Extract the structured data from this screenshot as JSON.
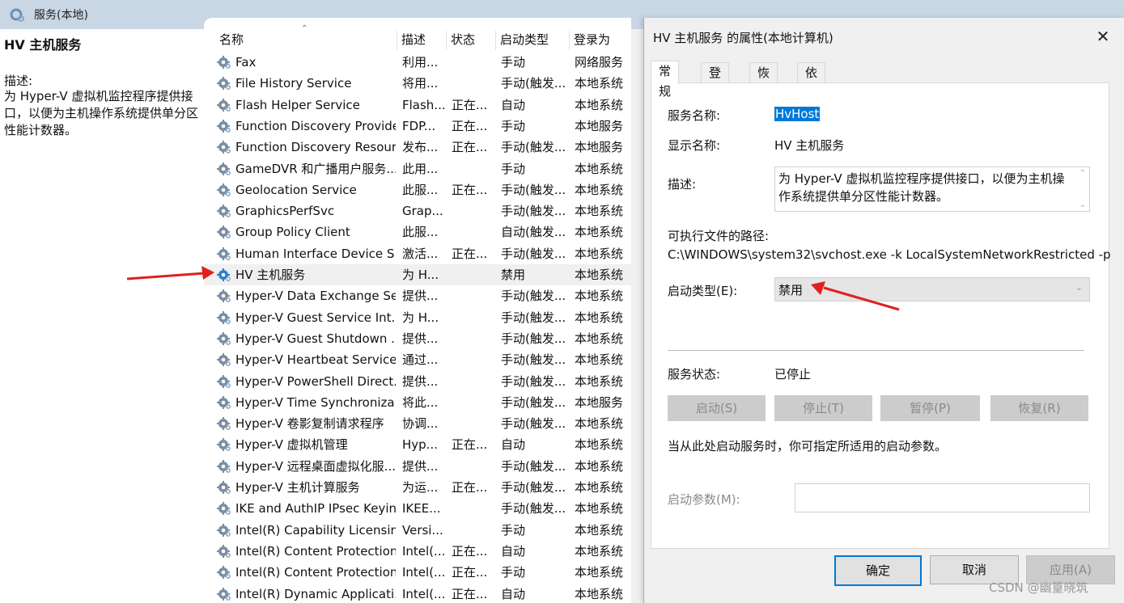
{
  "window": {
    "title": "服务(本地)"
  },
  "left_pane": {
    "service_title": "HV 主机服务",
    "description_label": "描述:",
    "description_text": "为 Hyper-V 虚拟机监控程序提供接口，以便为主机操作系统提供单分区性能计数器。"
  },
  "list": {
    "headers": {
      "name": "名称",
      "desc": "描述",
      "status": "状态",
      "startup": "启动类型",
      "logon": "登录为"
    },
    "rows": [
      {
        "name": "Fax",
        "desc": "利用...",
        "status": "",
        "startup": "手动",
        "logon": "网络服务"
      },
      {
        "name": "File History Service",
        "desc": "将用...",
        "status": "",
        "startup": "手动(触发...",
        "logon": "本地系统"
      },
      {
        "name": "Flash Helper Service",
        "desc": "Flash...",
        "status": "正在...",
        "startup": "自动",
        "logon": "本地系统"
      },
      {
        "name": "Function Discovery Provide...",
        "desc": "FDP...",
        "status": "正在...",
        "startup": "手动",
        "logon": "本地服务"
      },
      {
        "name": "Function Discovery Resour...",
        "desc": "发布...",
        "status": "正在...",
        "startup": "手动(触发...",
        "logon": "本地服务"
      },
      {
        "name": "GameDVR 和广播用户服务...",
        "desc": "此用...",
        "status": "",
        "startup": "手动",
        "logon": "本地系统"
      },
      {
        "name": "Geolocation Service",
        "desc": "此服...",
        "status": "正在...",
        "startup": "手动(触发...",
        "logon": "本地系统"
      },
      {
        "name": "GraphicsPerfSvc",
        "desc": "Grap...",
        "status": "",
        "startup": "手动(触发...",
        "logon": "本地系统"
      },
      {
        "name": "Group Policy Client",
        "desc": "此服...",
        "status": "",
        "startup": "自动(触发...",
        "logon": "本地系统"
      },
      {
        "name": "Human Interface Device S...",
        "desc": "激活...",
        "status": "正在...",
        "startup": "手动(触发...",
        "logon": "本地系统"
      },
      {
        "name": "HV 主机服务",
        "desc": "为 H...",
        "status": "",
        "startup": "禁用",
        "logon": "本地系统"
      },
      {
        "name": "Hyper-V Data Exchange Se...",
        "desc": "提供...",
        "status": "",
        "startup": "手动(触发...",
        "logon": "本地系统"
      },
      {
        "name": "Hyper-V Guest Service Int...",
        "desc": "为 H...",
        "status": "",
        "startup": "手动(触发...",
        "logon": "本地系统"
      },
      {
        "name": "Hyper-V Guest Shutdown ...",
        "desc": "提供...",
        "status": "",
        "startup": "手动(触发...",
        "logon": "本地系统"
      },
      {
        "name": "Hyper-V Heartbeat Service",
        "desc": "通过...",
        "status": "",
        "startup": "手动(触发...",
        "logon": "本地系统"
      },
      {
        "name": "Hyper-V PowerShell Direct...",
        "desc": "提供...",
        "status": "",
        "startup": "手动(触发...",
        "logon": "本地系统"
      },
      {
        "name": "Hyper-V Time Synchroniza...",
        "desc": "将此...",
        "status": "",
        "startup": "手动(触发...",
        "logon": "本地服务"
      },
      {
        "name": "Hyper-V 卷影复制请求程序",
        "desc": "协调...",
        "status": "",
        "startup": "手动(触发...",
        "logon": "本地系统"
      },
      {
        "name": "Hyper-V 虚拟机管理",
        "desc": "Hyp...",
        "status": "正在...",
        "startup": "自动",
        "logon": "本地系统"
      },
      {
        "name": "Hyper-V 远程桌面虚拟化服...",
        "desc": "提供...",
        "status": "",
        "startup": "手动(触发...",
        "logon": "本地系统"
      },
      {
        "name": "Hyper-V 主机计算服务",
        "desc": "为运...",
        "status": "正在...",
        "startup": "手动(触发...",
        "logon": "本地系统"
      },
      {
        "name": "IKE and AuthIP IPsec Keyin...",
        "desc": "IKEE...",
        "status": "",
        "startup": "手动(触发...",
        "logon": "本地系统"
      },
      {
        "name": "Intel(R) Capability Licensin...",
        "desc": "Versi...",
        "status": "",
        "startup": "手动",
        "logon": "本地系统"
      },
      {
        "name": "Intel(R) Content Protection...",
        "desc": "Intel(...",
        "status": "正在...",
        "startup": "自动",
        "logon": "本地系统"
      },
      {
        "name": "Intel(R) Content Protection...",
        "desc": "Intel(...",
        "status": "正在...",
        "startup": "手动",
        "logon": "本地系统"
      },
      {
        "name": "Intel(R) Dynamic Applicati...",
        "desc": "Intel(...",
        "status": "正在...",
        "startup": "自动",
        "logon": "本地系统"
      }
    ]
  },
  "dialog": {
    "title": "HV 主机服务 的属性(本地计算机)",
    "close_glyph": "✕",
    "tabs": [
      "常规",
      "登录",
      "恢复",
      "依存关系"
    ],
    "service_name_label": "服务名称:",
    "service_name_value": "HvHost",
    "display_name_label": "显示名称:",
    "display_name_value": "HV 主机服务",
    "description_label": "描述:",
    "description_value": "为 Hyper-V 虚拟机监控程序提供接口，以便为主机操作系统提供单分区性能计数器。",
    "exe_path_label": "可执行文件的路径:",
    "exe_path_value": "C:\\WINDOWS\\system32\\svchost.exe -k LocalSystemNetworkRestricted -p",
    "startup_type_label": "启动类型(E):",
    "startup_type_value": "禁用",
    "status_label": "服务状态:",
    "status_value": "已停止",
    "buttons": {
      "start": "启动(S)",
      "stop": "停止(T)",
      "pause": "暂停(P)",
      "resume": "恢复(R)"
    },
    "hint": "当从此处启动服务时，你可指定所适用的启动参数。",
    "params_label": "启动参数(M):",
    "params_value": "",
    "footer": {
      "ok": "确定",
      "cancel": "取消",
      "apply": "应用(A)"
    }
  },
  "watermark": "CSDN @幽篁晓筑",
  "colors": {
    "arrow": "#e02020",
    "selection": "#0078d7",
    "titlebar": "#c9d6e4"
  }
}
